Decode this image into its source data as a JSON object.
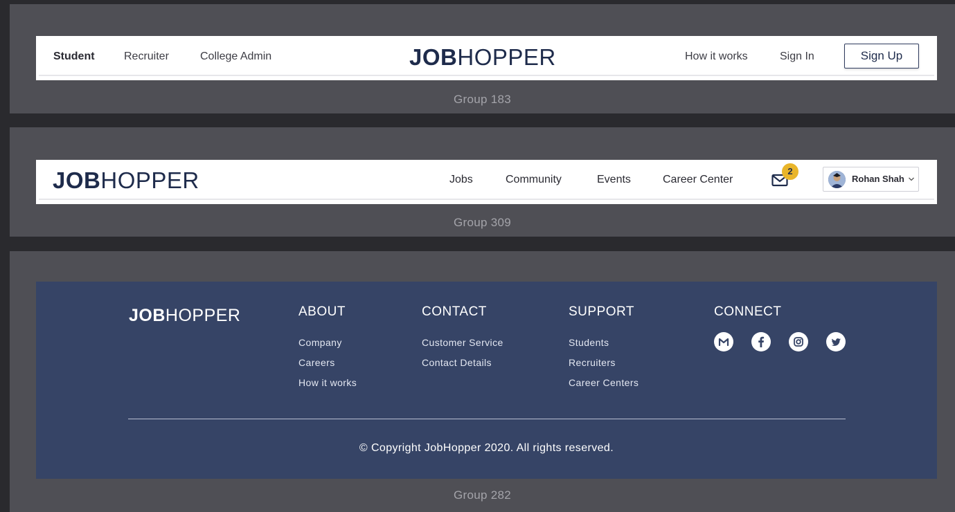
{
  "header_guest": {
    "nav_left": [
      "Student",
      "Recruiter",
      "College Admin"
    ],
    "logo_bold": "JOB",
    "logo_thin": "HOPPER",
    "how_it_works": "How it works",
    "sign_in": "Sign In",
    "sign_up": "Sign Up",
    "group_label": "Group 183"
  },
  "header_user": {
    "logo_bold": "JOB",
    "logo_thin": "HOPPER",
    "nav": [
      "Jobs",
      "Community",
      "Events",
      "Career Center"
    ],
    "mail_icon": "mail-icon",
    "notification_count": "2",
    "user_name": "Rohan Shah",
    "group_label": "Group 309"
  },
  "footer": {
    "logo_bold": "JOB",
    "logo_thin": "HOPPER",
    "columns": [
      {
        "heading": "ABOUT",
        "links": [
          "Company",
          "Careers",
          "How it works"
        ]
      },
      {
        "heading": "CONTACT",
        "links": [
          "Customer Service",
          "Contact Details"
        ]
      },
      {
        "heading": "SUPPORT",
        "links": [
          "Students",
          "Recruiters",
          "Career Centers"
        ]
      },
      {
        "heading": "CONNECT",
        "links": []
      }
    ],
    "social_icons": [
      "gmail-icon",
      "facebook-icon",
      "instagram-icon",
      "twitter-icon"
    ],
    "copyright": "© Copyright JobHopper 2020. All rights reserved.",
    "group_label": "Group 282"
  },
  "colors": {
    "brand_navy": "#1e2b4b",
    "footer_bg": "#364466",
    "badge": "#e9b52a",
    "panel_bg": "#4f4f55",
    "canvas_bg": "#2a2a2e"
  }
}
